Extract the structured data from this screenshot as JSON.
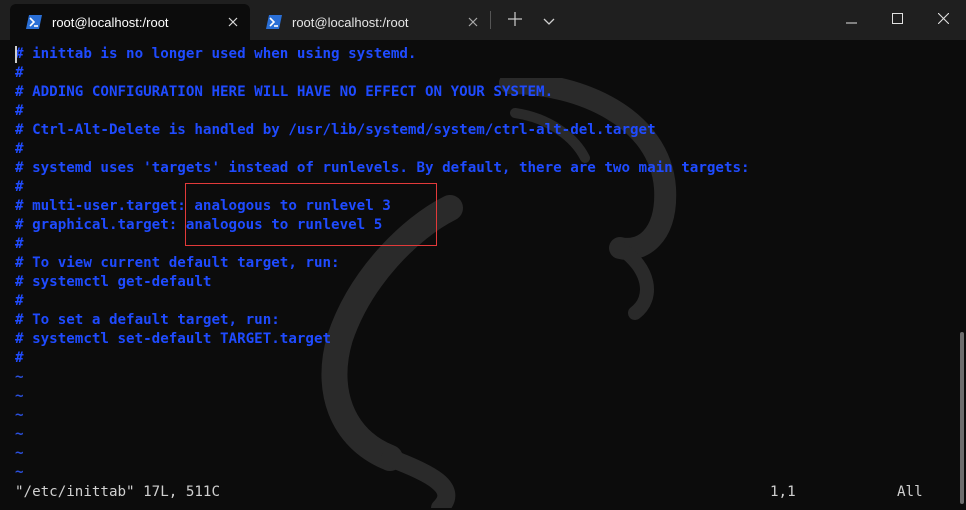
{
  "tabs": [
    {
      "label": "root@localhost:/root",
      "active": true,
      "icon": "powershell-icon"
    },
    {
      "label": "root@localhost:/root",
      "active": false,
      "icon": "powershell-icon"
    }
  ],
  "tab_actions": {
    "new_tab_icon": "plus-icon",
    "dropdown_icon": "chevron-down-icon"
  },
  "window_controls": {
    "minimize_icon": "minimize-icon",
    "maximize_icon": "maximize-icon",
    "close_icon": "close-icon"
  },
  "editor": {
    "lines": [
      "# inittab is no longer used when using systemd.",
      "#",
      "# ADDING CONFIGURATION HERE WILL HAVE NO EFFECT ON YOUR SYSTEM.",
      "#",
      "# Ctrl-Alt-Delete is handled by /usr/lib/systemd/system/ctrl-alt-del.target",
      "#",
      "# systemd uses 'targets' instead of runlevels. By default, there are two main targets:",
      "#",
      "# multi-user.target: analogous to runlevel 3",
      "# graphical.target: analogous to runlevel 5",
      "#",
      "# To view current default target, run:",
      "# systemctl get-default",
      "#",
      "# To set a default target, run:",
      "# systemctl set-default TARGET.target",
      "#"
    ],
    "empty_lines": [
      "~",
      "~",
      "~",
      "~",
      "~",
      "~"
    ],
    "status": {
      "file": "\"/etc/inittab\" 17L, 511C",
      "position": "1,1",
      "scroll": "All"
    }
  },
  "colors": {
    "comment_text": "#1f4bff",
    "background": "#0c0c0c",
    "highlight_box": "#e23a3a",
    "tabbar": "#1f1f1f"
  }
}
